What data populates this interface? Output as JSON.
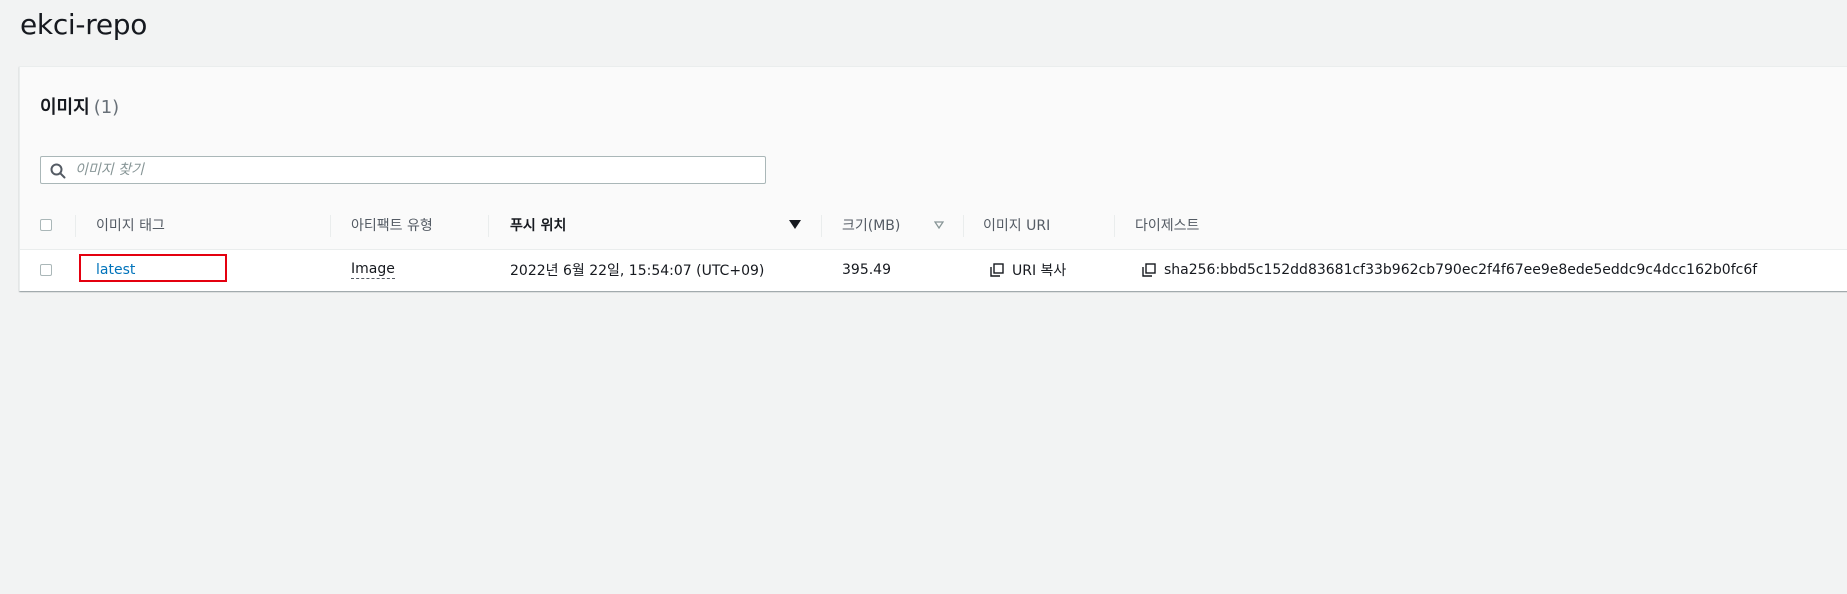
{
  "repo": {
    "name": "ekci-repo"
  },
  "images_panel": {
    "heading": "이미지",
    "count": "(1)",
    "search_placeholder": "이미지 찾기"
  },
  "table": {
    "columns": {
      "image_tag": "이미지 태그",
      "artifact_type": "아티팩트 유형",
      "pushed_at": "푸시 위치",
      "size": "크기(MB)",
      "image_uri": "이미지 URI",
      "digest": "다이제스트"
    },
    "sorted_column": "pushed_at",
    "sort_direction": "descending",
    "rows": [
      {
        "image_tag": "latest",
        "artifact_type": "Image",
        "pushed_at": "2022년 6월 22일, 15:54:07 (UTC+09)",
        "size": "395.49",
        "image_uri_label": "URI 복사",
        "digest": "sha256:bbd5c152dd83681cf33b962cb790ec2f4f67ee9e8ede5eddc9c4dcc162b0fc6f"
      }
    ]
  },
  "colors": {
    "link": "#0073bb",
    "highlight": "#e4000f",
    "background": "#f2f3f3"
  },
  "icons": {
    "search": "search-icon",
    "copy": "copy-icon",
    "sort_desc": "caret-down-icon",
    "sort_unsorted": "caret-down-outline-icon"
  }
}
